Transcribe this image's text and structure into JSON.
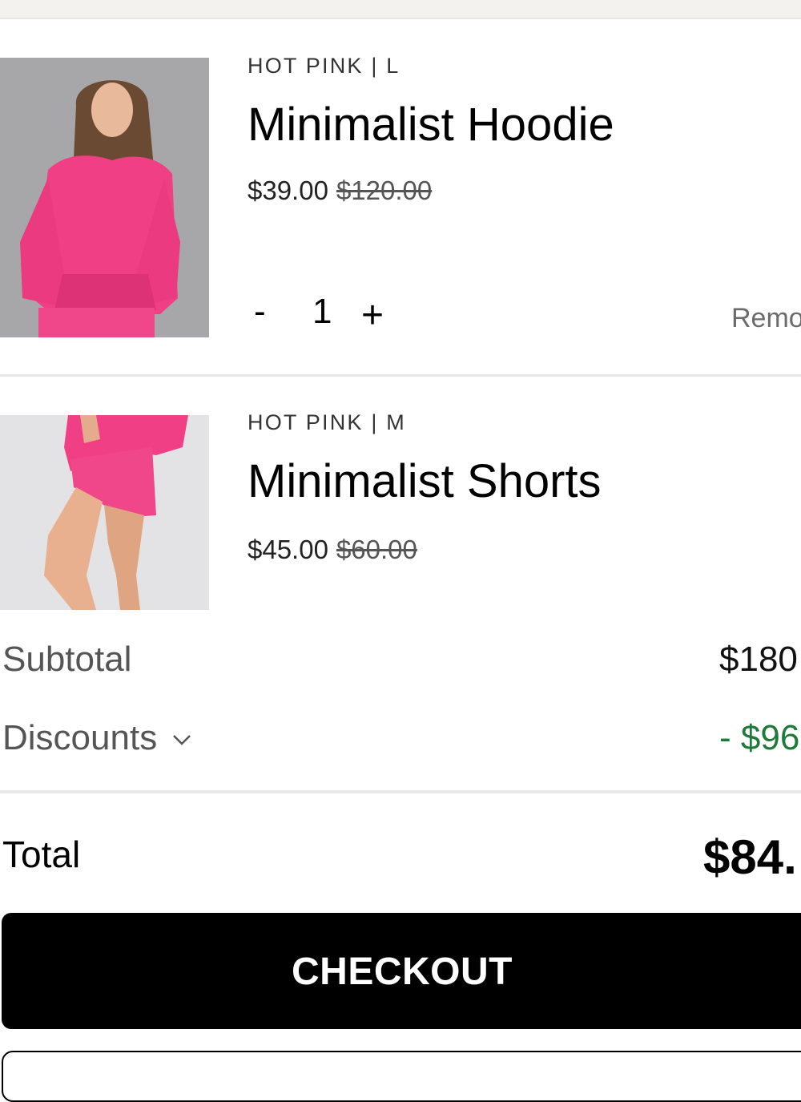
{
  "cart": {
    "items": [
      {
        "variant": "HOT PINK | L",
        "name": "Minimalist Hoodie",
        "price": "$39.00",
        "original_price": "$120.00",
        "quantity": "1",
        "decrement": "-",
        "increment": "+",
        "remove_label": "Remo"
      },
      {
        "variant": "HOT PINK | M",
        "name": "Minimalist Shorts",
        "price": "$45.00",
        "original_price": "$60.00"
      }
    ]
  },
  "summary": {
    "subtotal_label": "Subtotal",
    "subtotal_value": "$180",
    "discounts_label": "Discounts",
    "discounts_value": "- $96",
    "total_label": "Total",
    "total_value": "$84."
  },
  "checkout_label": "CHECKOUT",
  "colors": {
    "product_pink": "#f13f86",
    "discount_green": "#1f7a3a",
    "button_black": "#000000"
  }
}
